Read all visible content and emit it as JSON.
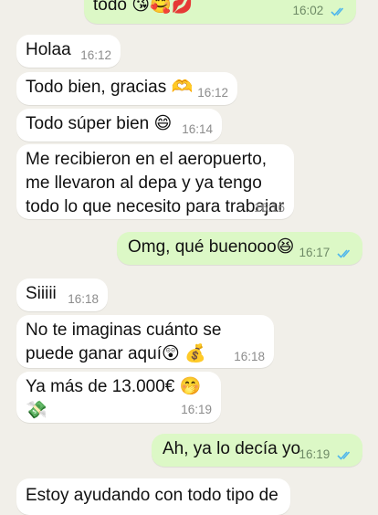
{
  "messages": [
    {
      "id": "m0",
      "dir": "out",
      "text": "todo 😘🥰💋",
      "time": "16:02",
      "read": true
    },
    {
      "id": "m1",
      "dir": "in",
      "text": "Holaa",
      "time": "16:12"
    },
    {
      "id": "m2",
      "dir": "in",
      "text": "Todo bien, gracias 🫶",
      "time": "16:12"
    },
    {
      "id": "m3",
      "dir": "in",
      "text": "Todo súper bien 😄",
      "time": "16:14"
    },
    {
      "id": "m4",
      "dir": "in",
      "text": "Me recibieron en el aeropuerto, me llevaron al depa y ya tengo todo lo que necesito para trabajar",
      "time": "16:16"
    },
    {
      "id": "m5",
      "dir": "out",
      "text": "Omg, qué buenooo😆",
      "time": "16:17",
      "read": true
    },
    {
      "id": "m6",
      "dir": "in",
      "text": "Siiiii",
      "time": "16:18"
    },
    {
      "id": "m7",
      "dir": "in",
      "text": "No te imaginas cuánto se puede ganar aquí😲 💰",
      "time": "16:18"
    },
    {
      "id": "m8",
      "dir": "in",
      "text": "Ya más de 13.000€ 🤭💸",
      "time": "16:19"
    },
    {
      "id": "m9",
      "dir": "out",
      "text": "Ah, ya lo decía yo",
      "time": "16:19",
      "read": true
    },
    {
      "id": "m10",
      "dir": "in",
      "text": "Estoy ayudando con todo tipo de",
      "time": ""
    }
  ],
  "colors": {
    "incoming": "#ffffff",
    "outgoing": "#dcf8c6",
    "background": "#f1efe9",
    "read_ticks": "#4fb6ec"
  }
}
